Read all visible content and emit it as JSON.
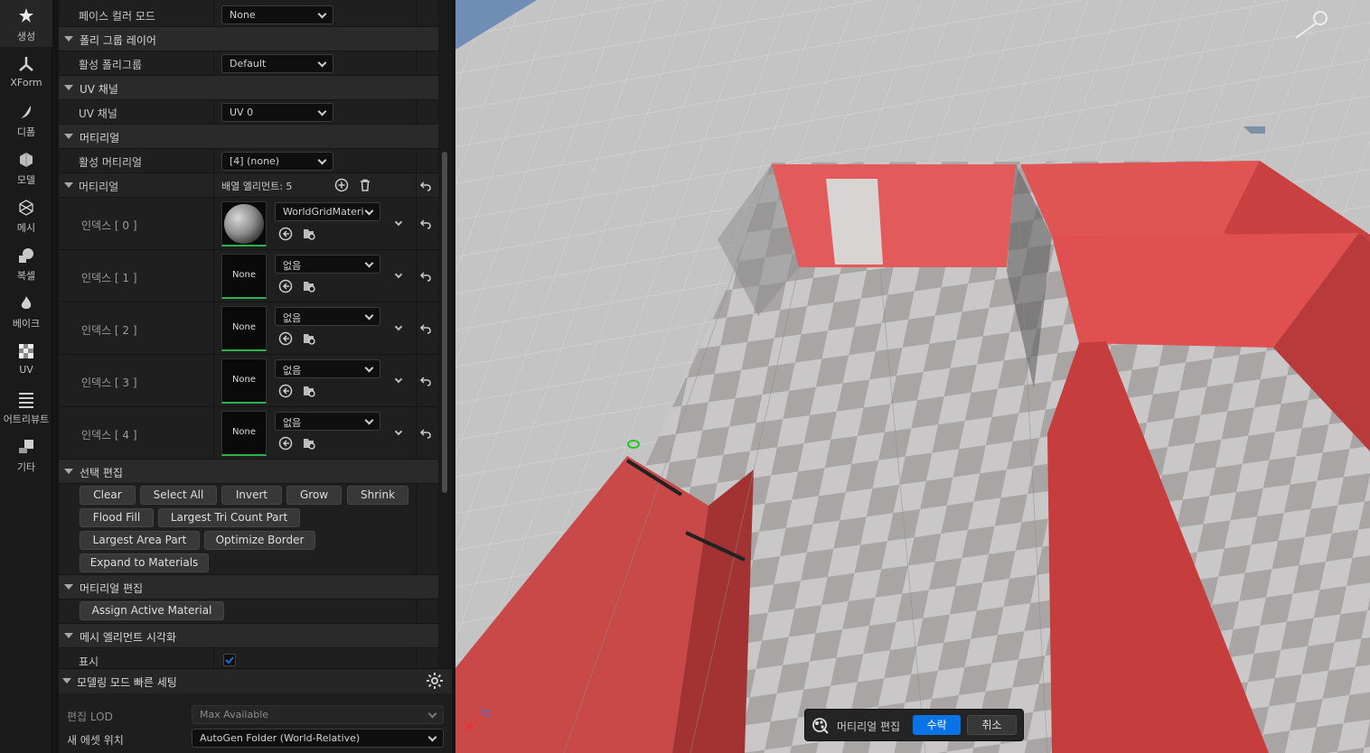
{
  "sidebar": {
    "tools": [
      {
        "label": "생성",
        "icon": "create-icon",
        "active": true
      },
      {
        "label": "XForm",
        "icon": "xform-icon"
      },
      {
        "label": "디폼",
        "icon": "deform-icon"
      },
      {
        "label": "모델",
        "icon": "model-icon"
      },
      {
        "label": "메시",
        "icon": "mesh-icon"
      },
      {
        "label": "복셀",
        "icon": "voxel-icon"
      },
      {
        "label": "베이크",
        "icon": "bake-icon"
      },
      {
        "label": "UV",
        "icon": "uv-icon"
      },
      {
        "label": "어트리뷰트",
        "icon": "attributes-icon"
      },
      {
        "label": "기타",
        "icon": "misc-icon"
      }
    ]
  },
  "panel": {
    "face_color_label": "페이스 컬러 모드",
    "face_color_value": "None",
    "polygroup_section": "폴리 그룹 레이어",
    "active_polygroup_label": "활성 폴리그룹",
    "active_polygroup_value": "Default",
    "uv_section": "UV 채널",
    "uv_label": "UV 채널",
    "uv_value": "UV 0",
    "material_section": "머티리얼",
    "active_material_label": "활성 머티리얼",
    "active_material_value": "[4] (none)",
    "materials_label": "머티리얼",
    "array_elements": "배열 엘리먼트: 5",
    "indices": [
      {
        "label": "인덱스 [ 0 ]",
        "value": "WorldGridMateri",
        "thumb": ""
      },
      {
        "label": "인덱스 [ 1 ]",
        "value": "없음",
        "thumb": "None"
      },
      {
        "label": "인덱스 [ 2 ]",
        "value": "없음",
        "thumb": "None"
      },
      {
        "label": "인덱스 [ 3 ]",
        "value": "없음",
        "thumb": "None"
      },
      {
        "label": "인덱스 [ 4 ]",
        "value": "없음",
        "thumb": "None"
      }
    ],
    "selection_section": "선택 편집",
    "selection_buttons": {
      "clear": "Clear",
      "select_all": "Select All",
      "invert": "Invert",
      "grow": "Grow",
      "shrink": "Shrink",
      "flood_fill": "Flood Fill",
      "largest_tri": "Largest Tri Count Part",
      "largest_area": "Largest Area Part",
      "optimize_border": "Optimize Border",
      "expand_materials": "Expand to Materials"
    },
    "material_edit_section": "머티리얼 편집",
    "assign_active_material": "Assign Active Material",
    "viz_section": "메시 엘리먼트 시각화",
    "show_label": "표시",
    "show_checked": true
  },
  "quick_settings": {
    "title": "모델링 모드 빠른 세팅",
    "lod_label": "편집 LOD",
    "lod_value": "Max Available",
    "asset_label": "새 에셋 위치",
    "asset_value": "AutoGen Folder (World-Relative)"
  },
  "toast": {
    "title": "머티리얼 편집",
    "accept": "수락",
    "cancel": "취소"
  },
  "gizmo": {
    "axis_label": "Z"
  },
  "colors": {
    "accent": "#0a74e6",
    "wall": "#d94f4f",
    "checkbox": "#1c6fd6"
  }
}
